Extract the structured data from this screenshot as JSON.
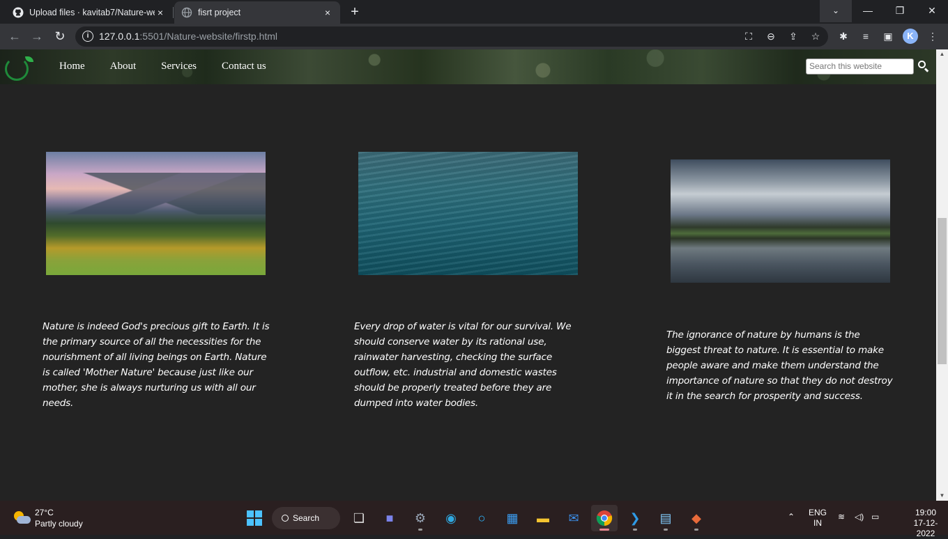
{
  "browser": {
    "tabs": [
      {
        "title": "Upload files · kavitab7/Nature-website",
        "close": "×"
      },
      {
        "title": "fisrt project",
        "close": "×"
      }
    ],
    "new_tab": "+",
    "window_controls": {
      "tab_search": "⌄",
      "minimize": "—",
      "maximize": "❐",
      "close": "✕"
    },
    "url_host": "127.0.0.1",
    "url_rest": ":5501/Nature-website/firstp.html",
    "profile_initial": "K"
  },
  "site": {
    "nav": [
      "Home",
      "About",
      "Services",
      "Contact us"
    ],
    "search_placeholder": "Search this website",
    "cards": [
      {
        "image": "green mountains under pink clouds",
        "text": "Nature is indeed God's precious gift to Earth. It is the primary source of all the necessities for the nourishment of all living beings on Earth. Nature is called 'Mother Nature' because just like our mother, she is always nurturing us with all our needs."
      },
      {
        "image": "rippling teal sea water",
        "text": "Every drop of water is vital for our survival. We should conserve water by its rational use, rainwater harvesting, checking the surface outflow, etc. industrial and domestic wastes should be properly treated before they are dumped into water bodies."
      },
      {
        "image": "lake with trees under streaking clouds",
        "text": "The ignorance of nature by humans is the biggest threat to nature. It is essential to make people aware and make them understand the importance of nature so that they do not destroy it in the search for prosperity and success."
      }
    ]
  },
  "taskbar": {
    "weather_temp": "27°C",
    "weather_desc": "Partly cloudy",
    "search_label": "Search",
    "lang_top": "ENG",
    "lang_bottom": "IN",
    "time": "19:00",
    "date": "17-12-2022"
  }
}
